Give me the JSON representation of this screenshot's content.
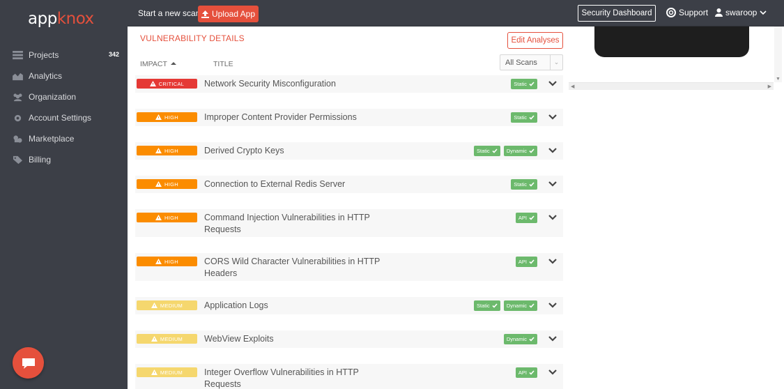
{
  "sidebar": {
    "logo_part1": "app",
    "logo_part2": "knox",
    "items": [
      {
        "label": "Projects",
        "badge": "342",
        "icon": "projects-icon"
      },
      {
        "label": "Analytics",
        "icon": "analytics-icon"
      },
      {
        "label": "Organization",
        "icon": "organization-icon"
      },
      {
        "label": "Account Settings",
        "icon": "gear-icon"
      },
      {
        "label": "Marketplace",
        "icon": "puzzle-icon"
      },
      {
        "label": "Billing",
        "icon": "tag-icon"
      }
    ],
    "chat_icon": "chat-icon"
  },
  "topbar": {
    "start_scan": "Start a new scan",
    "upload": "Upload App",
    "security_dashboard": "Security Dashboard",
    "support": "Support",
    "user": "swaroop"
  },
  "main": {
    "section_title": "VULNERABILITY DETAILS",
    "edit_analyses": "Edit Analyses",
    "col_impact": "IMPACT",
    "col_title": "TITLE",
    "scans_filter": "All Scans",
    "vulnerabilities": [
      {
        "impact": "CRITICAL",
        "title": "Network Security Misconfiguration",
        "tags": [
          "Static"
        ]
      },
      {
        "impact": "HIGH",
        "title": "Improper Content Provider Permissions",
        "tags": [
          "Static"
        ]
      },
      {
        "impact": "HIGH",
        "title": "Derived Crypto Keys",
        "tags": [
          "Static",
          "Dynamic"
        ]
      },
      {
        "impact": "HIGH",
        "title": "Connection to External Redis Server",
        "tags": [
          "Static"
        ]
      },
      {
        "impact": "HIGH",
        "title": "Command Injection Vulnerabilities in HTTP Requests",
        "tags": [
          "API"
        ]
      },
      {
        "impact": "HIGH",
        "title": "CORS Wild Character Vulnerabilities in HTTP Headers",
        "tags": [
          "API"
        ]
      },
      {
        "impact": "MEDIUM",
        "title": "Application Logs",
        "tags": [
          "Static",
          "Dynamic"
        ]
      },
      {
        "impact": "MEDIUM",
        "title": "WebView Exploits",
        "tags": [
          "Dynamic"
        ]
      },
      {
        "impact": "MEDIUM",
        "title": "Integer Overflow Vulnerabilities in HTTP Requests",
        "tags": [
          "API"
        ]
      }
    ]
  },
  "colors": {
    "brand": "#e5503c",
    "sidebar_bg": "#3c3f47",
    "critical": "#e53935",
    "high": "#fb8c00",
    "medium": "#f5d76e",
    "tag_green": "#6cb96c"
  }
}
